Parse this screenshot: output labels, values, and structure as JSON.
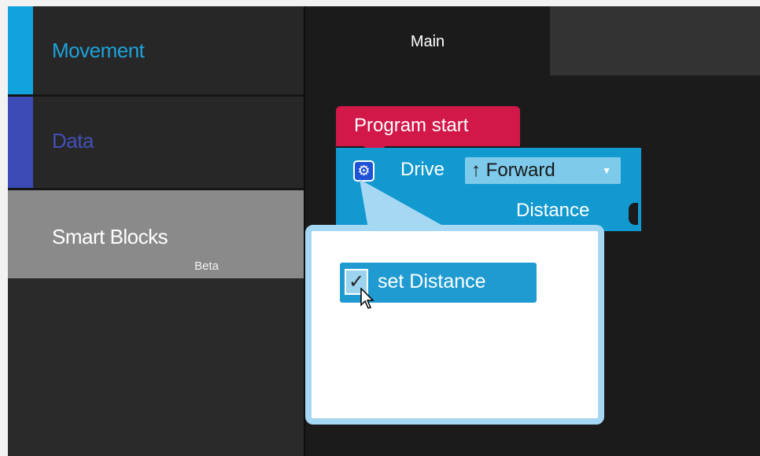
{
  "sidebar": {
    "categories": [
      {
        "label": "Movement",
        "color": "#1da3dc"
      },
      {
        "label": "Data",
        "color": "#4350b8"
      },
      {
        "label": "Smart Blocks",
        "sublabel": "Beta",
        "selected": true
      }
    ]
  },
  "tabs": [
    {
      "label": "Main",
      "active": true
    }
  ],
  "blocks": {
    "hat": {
      "label": "Program start",
      "color": "#d21749"
    },
    "drive": {
      "label": "Drive",
      "direction": "↑ Forward",
      "dropdown_arrow": "▼",
      "input_label": "Distance",
      "settings_icon": "gear-icon",
      "color": "#1299d0"
    }
  },
  "mutator": {
    "option_label": "set Distance",
    "checked": true,
    "check_glyph": "✓"
  }
}
